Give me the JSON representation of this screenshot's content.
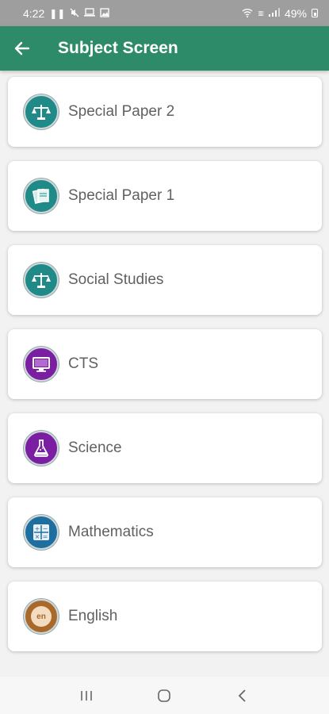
{
  "status_bar": {
    "time": "4:22",
    "battery": "49%"
  },
  "app_bar": {
    "title": "Subject Screen"
  },
  "subjects": [
    {
      "label": "Special Paper 2",
      "icon": "scales-icon",
      "color": "#1f8a87"
    },
    {
      "label": "Special Paper 1",
      "icon": "papers-icon",
      "color": "#1f8a87"
    },
    {
      "label": "Social Studies",
      "icon": "scales-icon",
      "color": "#1f8a87"
    },
    {
      "label": "CTS",
      "icon": "monitor-icon",
      "color": "#7b1fa2"
    },
    {
      "label": "Science",
      "icon": "flask-icon",
      "color": "#7b1fa2"
    },
    {
      "label": "Mathematics",
      "icon": "calculator-icon",
      "color": "#1e6f9f"
    },
    {
      "label": "English",
      "icon": "en-icon",
      "color": "#a8692a",
      "icon_text": "en"
    }
  ],
  "colors": {
    "app_bar": "#2e8b6a",
    "status_bar": "#9e9e9e"
  }
}
